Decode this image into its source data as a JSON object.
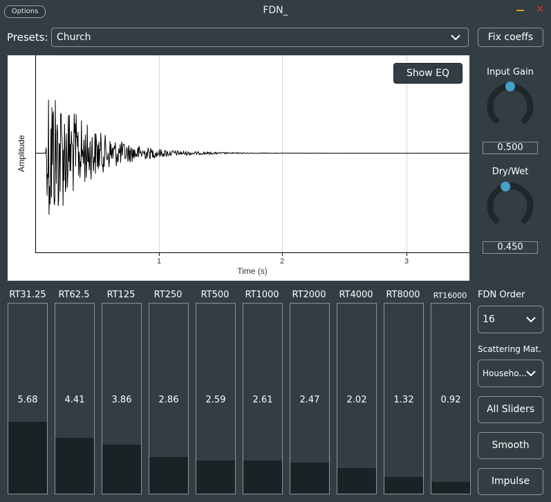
{
  "titlebar": {
    "options_label": "Options",
    "title": "FDN_",
    "close_glyph": "✕"
  },
  "presets": {
    "label": "Presets:",
    "value": "Church"
  },
  "toolbar": {
    "fix_coeffs_label": "Fix coeffs"
  },
  "plot": {
    "ylabel": "Amplitude",
    "xlabel": "Time (s)",
    "ticks": [
      "1",
      "2",
      "3"
    ],
    "show_eq_label": "Show EQ"
  },
  "knobs": {
    "input_gain": {
      "label": "Input Gain",
      "value": "0.500",
      "level": 0.5
    },
    "dry_wet": {
      "label": "Dry/Wet",
      "value": "0.450",
      "level": 0.45
    }
  },
  "bands": [
    {
      "label": "RT31.25",
      "value": "5.68",
      "fill": 0.38
    },
    {
      "label": "RT62.5",
      "value": "4.41",
      "fill": 0.295
    },
    {
      "label": "RT125",
      "value": "3.86",
      "fill": 0.258
    },
    {
      "label": "RT250",
      "value": "2.86",
      "fill": 0.191
    },
    {
      "label": "RT500",
      "value": "2.59",
      "fill": 0.173
    },
    {
      "label": "RT1000",
      "value": "2.61",
      "fill": 0.174
    },
    {
      "label": "RT2000",
      "value": "2.47",
      "fill": 0.165
    },
    {
      "label": "RT4000",
      "value": "2.02",
      "fill": 0.135
    },
    {
      "label": "RT8000",
      "value": "1.32",
      "fill": 0.088
    },
    {
      "label": "RT16000",
      "value": "0.92",
      "fill": 0.061
    }
  ],
  "fdn_order": {
    "label": "FDN Order",
    "value": "16"
  },
  "scattering": {
    "label": "Scattering Mat.",
    "value": "Househo..."
  },
  "buttons": {
    "all_sliders": "All Sliders",
    "smooth": "Smooth",
    "impulse": "Impulse"
  },
  "colors": {
    "background": "#323e44",
    "knob_thumb": "#42a2c8",
    "slider_fill": "#1b2226",
    "minimize": "#e0a020",
    "close": "#d63030"
  }
}
